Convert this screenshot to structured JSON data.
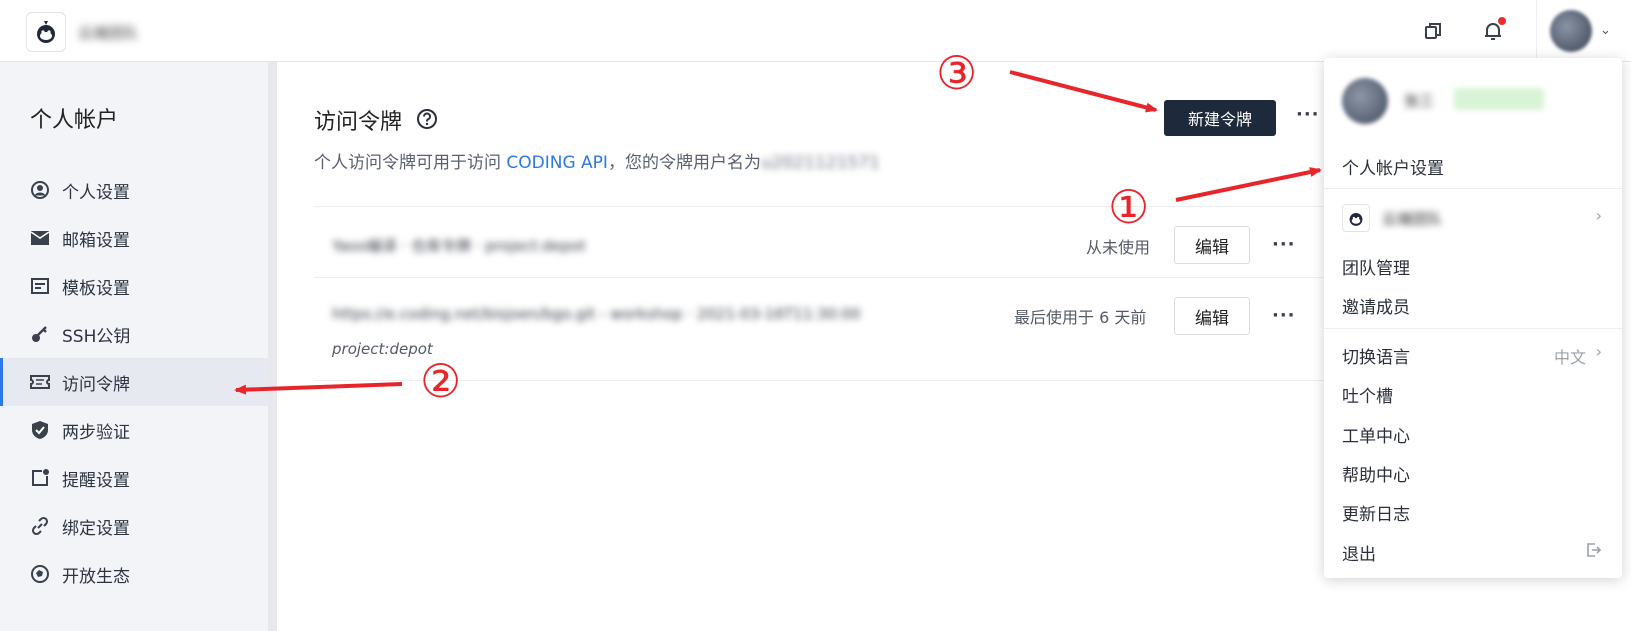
{
  "topbar": {
    "team_name": "云端团队"
  },
  "sidebar": {
    "title": "个人帐户",
    "items": [
      {
        "label": "个人设置",
        "icon": "user-circle-icon"
      },
      {
        "label": "邮箱设置",
        "icon": "mail-icon"
      },
      {
        "label": "模板设置",
        "icon": "template-icon"
      },
      {
        "label": "SSH公钥",
        "icon": "key-icon"
      },
      {
        "label": "访问令牌",
        "icon": "ticket-icon",
        "active": true
      },
      {
        "label": "两步验证",
        "icon": "shield-check-icon"
      },
      {
        "label": "提醒设置",
        "icon": "notification-icon"
      },
      {
        "label": "绑定设置",
        "icon": "link-icon"
      },
      {
        "label": "开放生态",
        "icon": "ecosystem-icon"
      }
    ]
  },
  "main": {
    "title": "访问令牌",
    "desc_prefix": "个人访问令牌可用于访问 ",
    "desc_link": "CODING API",
    "desc_suffix": "，您的令牌用户名为",
    "desc_username": "u2021121571",
    "new_button": "新建令牌",
    "tokens": [
      {
        "name": "Yaoo编译 · 仓库令牌 · project:depot",
        "usage": "从未使用",
        "edit": "编辑"
      },
      {
        "name": "https://e.coding.net/bisjoen/bgo.git - workshop · 2021-03-16T11:30:00",
        "scope": "project:depot",
        "usage": "最后使用于 6 天前",
        "edit": "编辑"
      }
    ]
  },
  "dropdown": {
    "username": "张三",
    "account_settings": "个人帐户设置",
    "team_name": "云端团队",
    "team_manage": "团队管理",
    "invite": "邀请成员",
    "switch_lang": "切换语言",
    "lang_value": "中文",
    "feedback": "吐个槽",
    "tickets": "工单中心",
    "help": "帮助中心",
    "changelog": "更新日志",
    "logout": "退出"
  },
  "annotations": [
    "①",
    "②",
    "③"
  ],
  "colors": {
    "accent": "#2b79e5",
    "dark_button": "#1e2a3b",
    "annotation": "#e8262a",
    "notification": "#ea2f2f"
  }
}
